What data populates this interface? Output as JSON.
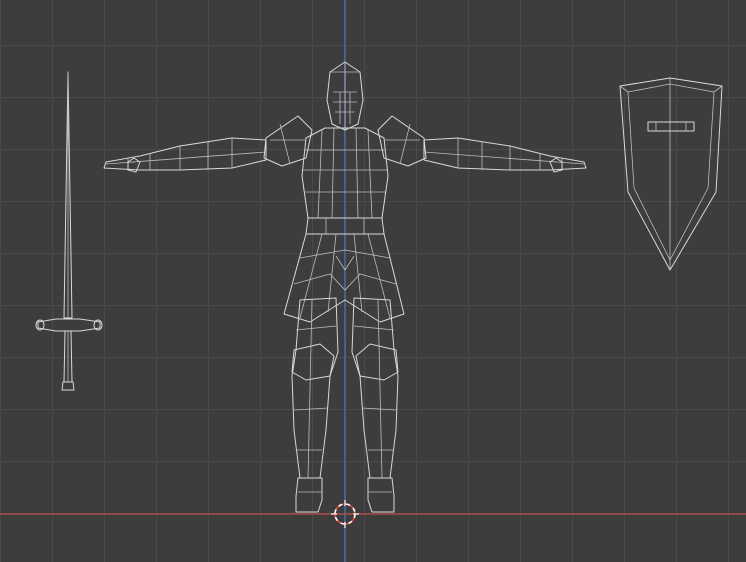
{
  "viewport": {
    "background_color": "#3d3d3d",
    "grid_color": "#4a4a4a",
    "wireframe_color": "#d9d9d9",
    "axis_colors": {
      "z": "#4b77c9",
      "x": "#c44a4a"
    },
    "cursor_color": "#e04a3a"
  },
  "objects": [
    {
      "kind": "sword",
      "icon": "sword-icon"
    },
    {
      "kind": "knight",
      "icon": "knight-icon"
    },
    {
      "kind": "shield",
      "icon": "shield-icon"
    }
  ],
  "tools": {
    "cursor_icon": "3d-cursor-icon"
  }
}
